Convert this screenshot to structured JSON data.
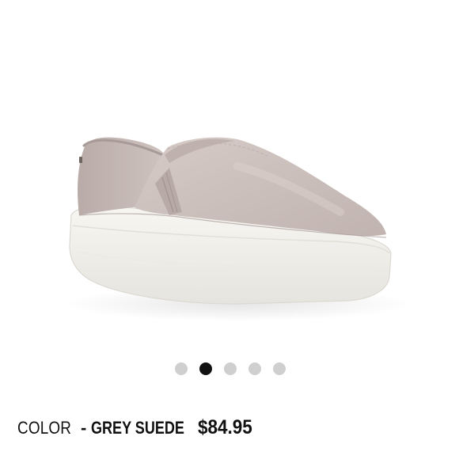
{
  "product": {
    "image_alt": "grey suede slip-on sneaker with white platform sole",
    "color_label": "COLOR",
    "color_separator": "-",
    "color_value": "GREY SUEDE",
    "price": "$84.95",
    "colors": {
      "suede": "#cbbfbb",
      "sole": "#f3f2ee",
      "active_dot": "#111111",
      "inactive_dot": "#cfcfcf"
    }
  },
  "carousel": {
    "total": 5,
    "active_index": 1
  }
}
